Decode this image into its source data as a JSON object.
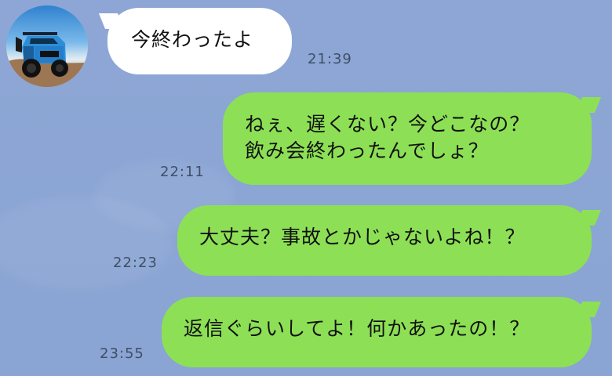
{
  "messages": [
    {
      "side": "left",
      "text": "今終わったよ",
      "time": "21:39"
    },
    {
      "side": "right",
      "lines": [
        "ねぇ、遅くない？今どこなの？",
        "飲み会終わったんでしょ？"
      ],
      "time": "22:11"
    },
    {
      "side": "right",
      "text": "大丈夫？事故とかじゃないよね！？",
      "time": "22:23"
    },
    {
      "side": "right",
      "text": "返信ぐらいしてよ！何かあったの！？",
      "time": "23:55"
    }
  ],
  "avatar": {
    "icon": "jeep-photo-avatar"
  },
  "colors": {
    "background": "#8ea7d6",
    "incoming_bubble": "#ffffff",
    "outgoing_bubble": "#8de055",
    "timestamp": "#3f4f67"
  }
}
